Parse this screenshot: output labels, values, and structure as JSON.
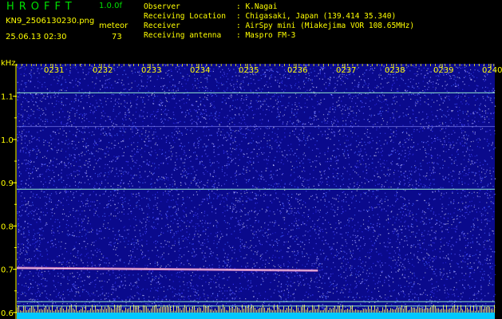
{
  "header": {
    "app_name": "HROFFT",
    "version": "1.0.0f",
    "filename": "KN9_2506130230.png",
    "mode": "meteor",
    "datetime": "25.06.13 02:30",
    "count": "73"
  },
  "meta": [
    {
      "label": "Observer",
      "value": ": K.Nagai"
    },
    {
      "label": "Receiving Location",
      "value": ": Chigasaki, Japan (139.414 35.340)"
    },
    {
      "label": "Receiver",
      "value": ": AirSpy mini (Miakejima VOR 108.65MHz)"
    },
    {
      "label": "Receiving antenna",
      "value": ": Maspro FM-3"
    }
  ],
  "colors": {
    "header_green": "#00e000",
    "header_yellow": "#ffff00",
    "background": "#000000",
    "spectrogram_base": "#0a0a8c",
    "axis_yellow": "#ffff00",
    "baseline_cyan": "#00e5ff"
  },
  "chart_data": {
    "type": "heatmap",
    "ylabel": "kHz",
    "x_ticks": [
      "0231",
      "0232",
      "0233",
      "0234",
      "0235",
      "0236",
      "0237",
      "0238",
      "0239",
      "0240"
    ],
    "y_ticks": [
      {
        "label": "1.1",
        "value": 1.1
      },
      {
        "label": "1.0",
        "value": 1.0
      },
      {
        "label": "0.9",
        "value": 0.9
      },
      {
        "label": "0.8",
        "value": 0.8
      },
      {
        "label": "0.7",
        "value": 0.7
      },
      {
        "label": "0.6",
        "value": 0.6
      }
    ],
    "ylim": [
      0.585,
      1.175
    ],
    "carrier_lines_khz": [
      1.108,
      1.03,
      0.885,
      0.625,
      0.615
    ],
    "meteor_trace": {
      "freq_start_khz": 0.703,
      "freq_end_khz": 0.697,
      "time_start_frac": 0.0,
      "time_end_frac": 0.63
    }
  }
}
